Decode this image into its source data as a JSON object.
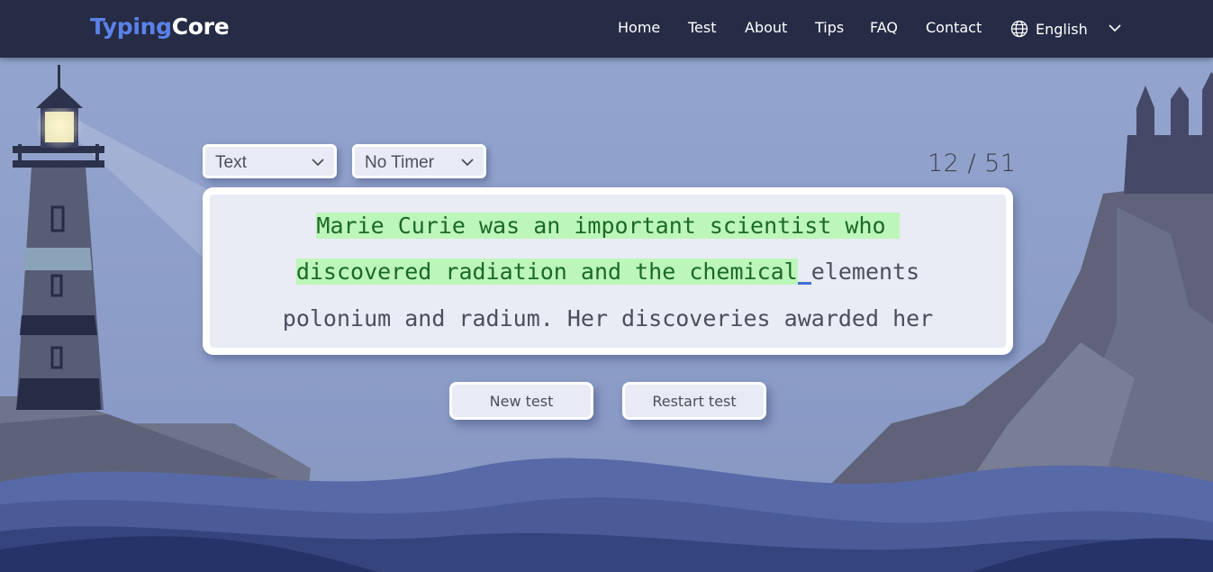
{
  "brand": {
    "part1": "Typing",
    "part2": "Core"
  },
  "nav": {
    "items": [
      "Home",
      "Test",
      "About",
      "Tips",
      "FAQ",
      "Contact"
    ],
    "language": "English"
  },
  "controls": {
    "mode": "Text",
    "timer": "No Timer",
    "progress": "12 / 51"
  },
  "passage": {
    "line1_typed": "Marie Curie was an important scientist who ",
    "line2_typed": "discovered radiation and the chemical",
    "line2_rest": "elements",
    "line3": "polonium and radium. Her discoveries awarded her"
  },
  "buttons": {
    "new_test": "New test",
    "restart_test": "Restart test"
  },
  "colors": {
    "navbar": "#262c46",
    "brand_accent": "#5b82ea",
    "typed_bg": "#bdf6ba",
    "typed_text": "#1a6a25",
    "cursor": "#3f6fd6"
  }
}
